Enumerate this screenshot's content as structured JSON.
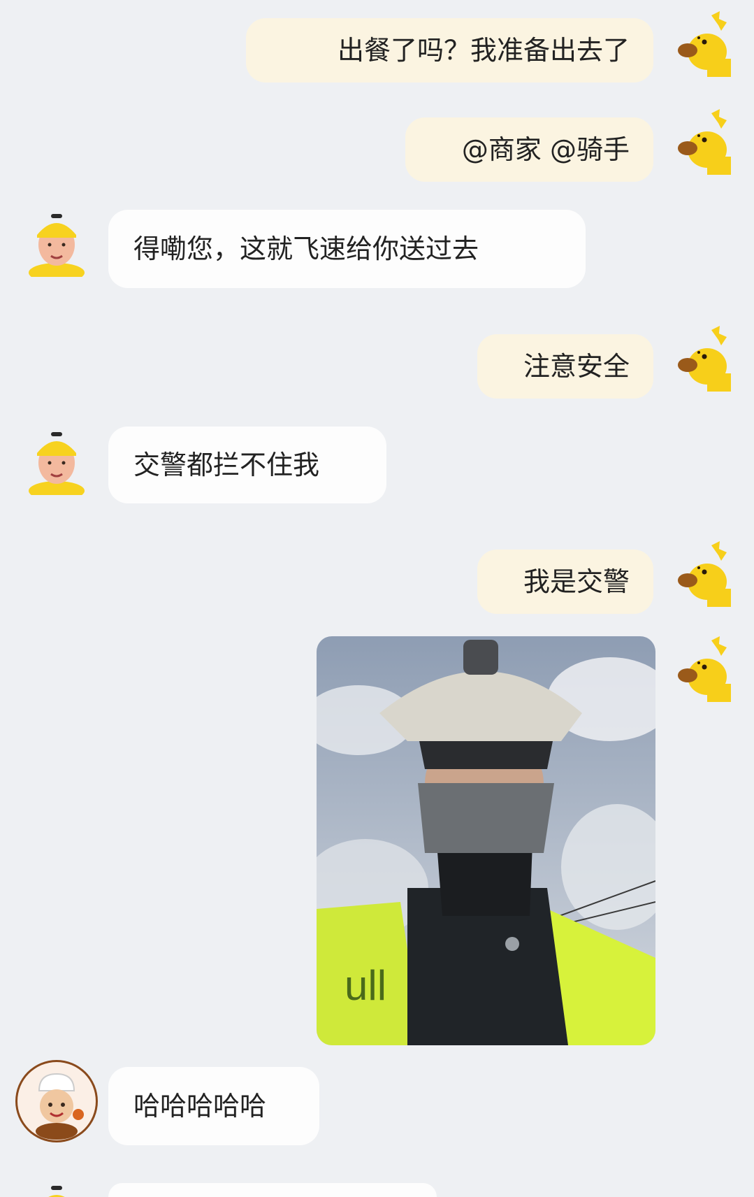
{
  "messages": [
    {
      "side": "out",
      "sender": "customer",
      "text": "出餐了吗？我准备出去了"
    },
    {
      "side": "out",
      "sender": "customer",
      "text": "@商家 @骑手"
    },
    {
      "side": "in",
      "sender": "rider",
      "text": "得嘞您，这就飞速给你送过去"
    },
    {
      "side": "out",
      "sender": "customer",
      "text": "注意安全"
    },
    {
      "side": "in",
      "sender": "rider",
      "text": "交警都拦不住我"
    },
    {
      "side": "out",
      "sender": "customer",
      "text": "我是交警"
    },
    {
      "side": "out",
      "sender": "customer",
      "type": "image",
      "image": "traffic-police-selfie"
    },
    {
      "side": "in",
      "sender": "merchant",
      "text": "哈哈哈哈哈"
    }
  ],
  "avatars": {
    "customer": "yellow-kangaroo-icon",
    "rider": "delivery-rider-icon",
    "merchant": "chef-boy-icon"
  },
  "colors": {
    "background": "#eef0f3",
    "outgoing_bubble": "#fbf4e1",
    "incoming_bubble": "#fdfdfd",
    "kangaroo_yellow": "#f7cf1a",
    "vest_yellow_green": "#d7f23b"
  }
}
